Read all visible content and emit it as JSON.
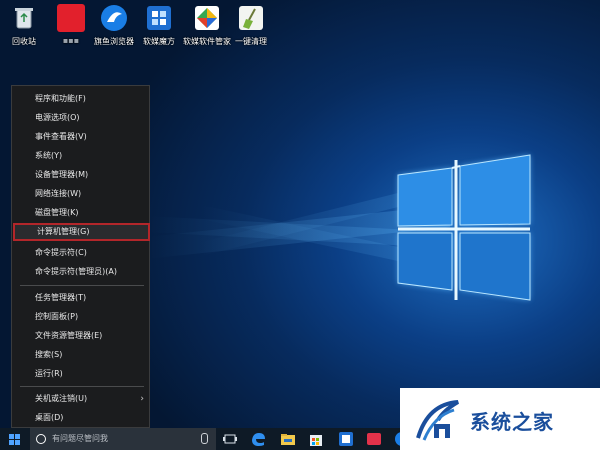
{
  "desktop_icons": [
    {
      "label": "回收站",
      "icon": "recycle-bin-icon"
    },
    {
      "label": "",
      "icon": "blurred-app-icon"
    },
    {
      "label": "旗鱼浏览器",
      "icon": "browser-icon"
    },
    {
      "label": "软媒魔方",
      "icon": "cube-icon"
    },
    {
      "label": "软媒软件管家",
      "icon": "software-manager-icon"
    },
    {
      "label": "一键清理",
      "icon": "broom-icon"
    }
  ],
  "context_menu": {
    "group1": [
      {
        "label": "程序和功能(F)"
      },
      {
        "label": "电源选项(O)"
      },
      {
        "label": "事件查看器(V)"
      },
      {
        "label": "系统(Y)"
      },
      {
        "label": "设备管理器(M)"
      },
      {
        "label": "网络连接(W)"
      },
      {
        "label": "磁盘管理(K)"
      },
      {
        "label": "计算机管理(G)",
        "highlighted": true
      },
      {
        "label": "命令提示符(C)"
      },
      {
        "label": "命令提示符(管理员)(A)"
      }
    ],
    "group2": [
      {
        "label": "任务管理器(T)"
      },
      {
        "label": "控制面板(P)"
      },
      {
        "label": "文件资源管理器(E)"
      },
      {
        "label": "搜索(S)"
      },
      {
        "label": "运行(R)"
      }
    ],
    "group3": [
      {
        "label": "关机或注销(U)",
        "submenu_arrow": "›"
      },
      {
        "label": "桌面(D)"
      }
    ]
  },
  "taskbar": {
    "search_placeholder": "有问题尽管问我",
    "icons": [
      "task-view-icon",
      "edge-icon",
      "file-explorer-icon",
      "store-icon",
      "cube-app-icon",
      "red-app-icon",
      "browser-partial-icon"
    ]
  },
  "watermark": {
    "text": "系统之家"
  },
  "colors": {
    "menu_bg": "#1b1c1e",
    "highlight_border": "#b3262a",
    "taskbar_bg": "#0e1a26",
    "accent": "#4fa3ff"
  }
}
